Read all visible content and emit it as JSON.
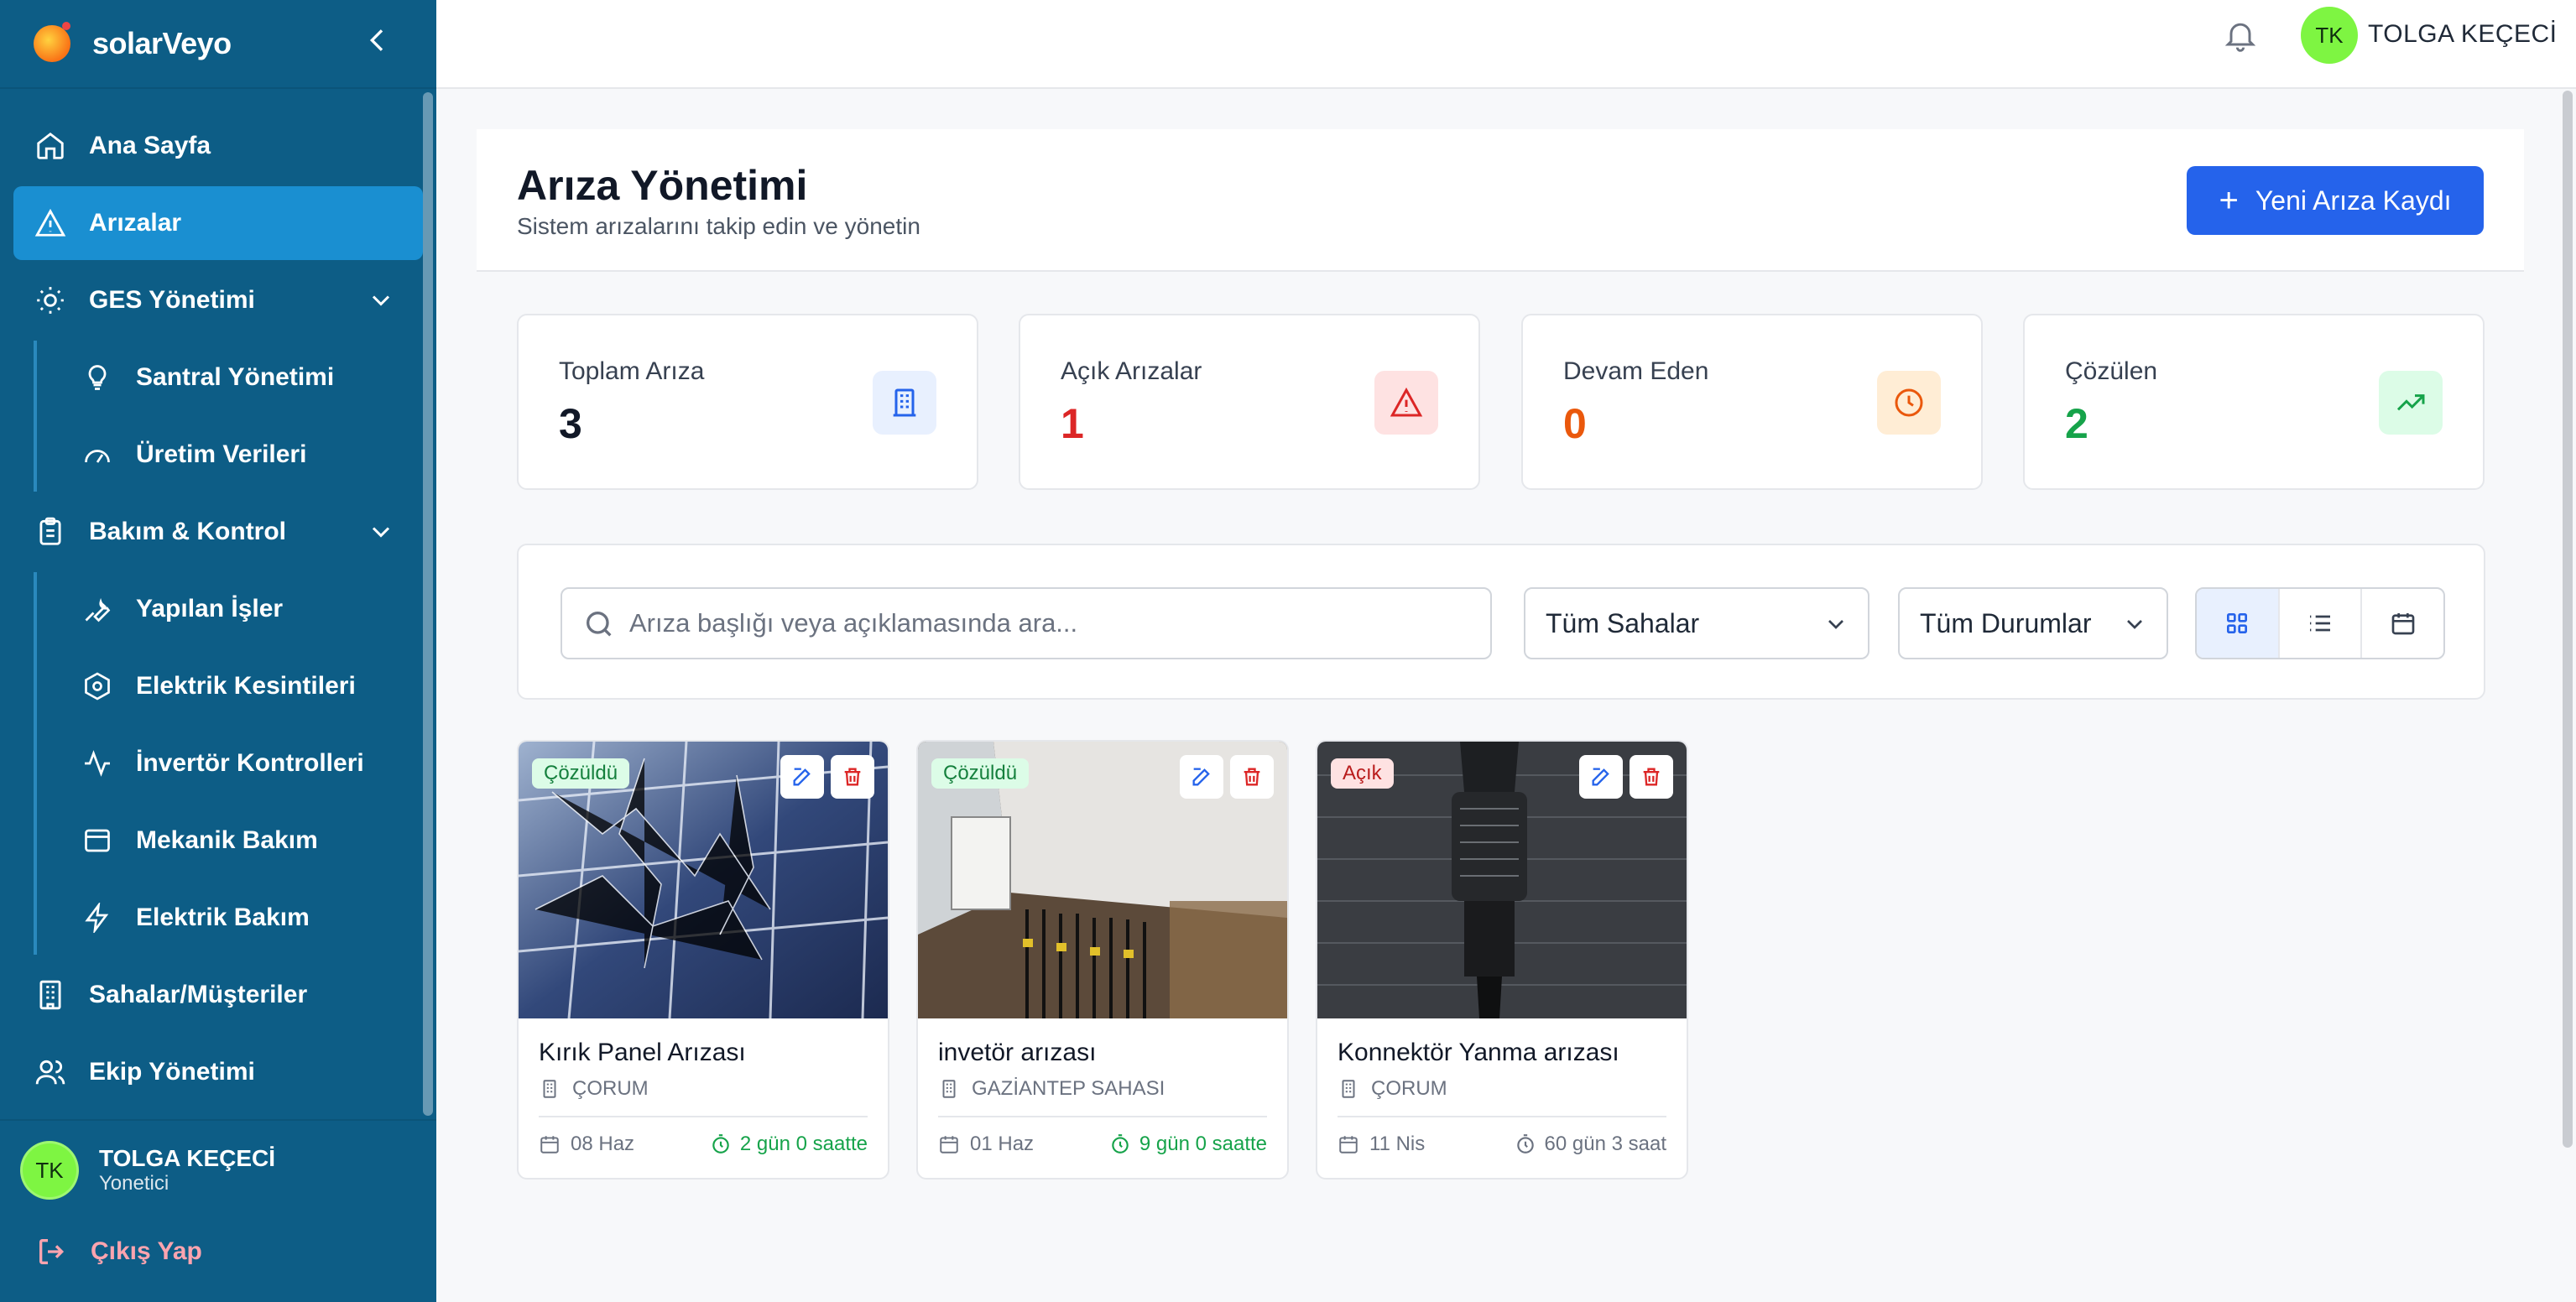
{
  "app": {
    "brand": "solarVeyo"
  },
  "sidebar": {
    "items": [
      {
        "label": "Ana Sayfa",
        "icon": "home-icon"
      },
      {
        "label": "Arızalar",
        "icon": "alert-triangle-icon",
        "active": true
      },
      {
        "label": "GES Yönetimi",
        "icon": "sun-icon"
      },
      {
        "label": "Santral Yönetimi",
        "icon": "lightbulb-icon"
      },
      {
        "label": "Üretim Verileri",
        "icon": "gauge-icon"
      },
      {
        "label": "Bakım & Kontrol",
        "icon": "clipboard-icon"
      },
      {
        "label": "Yapılan İşler",
        "icon": "wrench-icon"
      },
      {
        "label": "Elektrik Kesintileri",
        "icon": "hexagon-icon"
      },
      {
        "label": "İnvertör Kontrolleri",
        "icon": "activity-icon"
      },
      {
        "label": "Mekanik Bakım",
        "icon": "panel-icon"
      },
      {
        "label": "Elektrik Bakım",
        "icon": "bolt-icon"
      },
      {
        "label": "Sahalar/Müşteriler",
        "icon": "building-icon"
      },
      {
        "label": "Ekip Yönetimi",
        "icon": "users-icon"
      }
    ],
    "user": {
      "initials": "TK",
      "name": "TOLGA KEÇECİ",
      "role": "Yonetici"
    },
    "logout": "Çıkış Yap"
  },
  "topbar": {
    "initials": "TK",
    "name": "TOLGA KEÇECİ"
  },
  "page": {
    "title": "Arıza Yönetimi",
    "subtitle": "Sistem arızalarını takip edin ve yönetin",
    "new_button": "Yeni Arıza Kaydı"
  },
  "stats": [
    {
      "label": "Toplam Arıza",
      "value": "3",
      "color": "#111827"
    },
    {
      "label": "Açık Arızalar",
      "value": "1",
      "color": "#dc2626"
    },
    {
      "label": "Devam Eden",
      "value": "0",
      "color": "#ea580c"
    },
    {
      "label": "Çözülen",
      "value": "2",
      "color": "#16a34a"
    }
  ],
  "filters": {
    "search_placeholder": "Arıza başlığı veya açıklamasında ara...",
    "site_select": "Tüm Sahalar",
    "status_select": "Tüm Durumlar"
  },
  "cards": [
    {
      "status": "Çözüldü",
      "title": "Kırık Panel Arızası",
      "site": "ÇORUM",
      "date": "08 Haz",
      "duration": "2 gün 0 saatte"
    },
    {
      "status": "Çözüldü",
      "title": "invetör arızası",
      "site": "GAZİANTEP SAHASI",
      "date": "01 Haz",
      "duration": "9 gün 0 saatte"
    },
    {
      "status": "Açık",
      "title": "Konnektör Yanma arızası",
      "site": "ÇORUM",
      "date": "11 Nis",
      "duration": "60 gün 3 saat"
    }
  ]
}
